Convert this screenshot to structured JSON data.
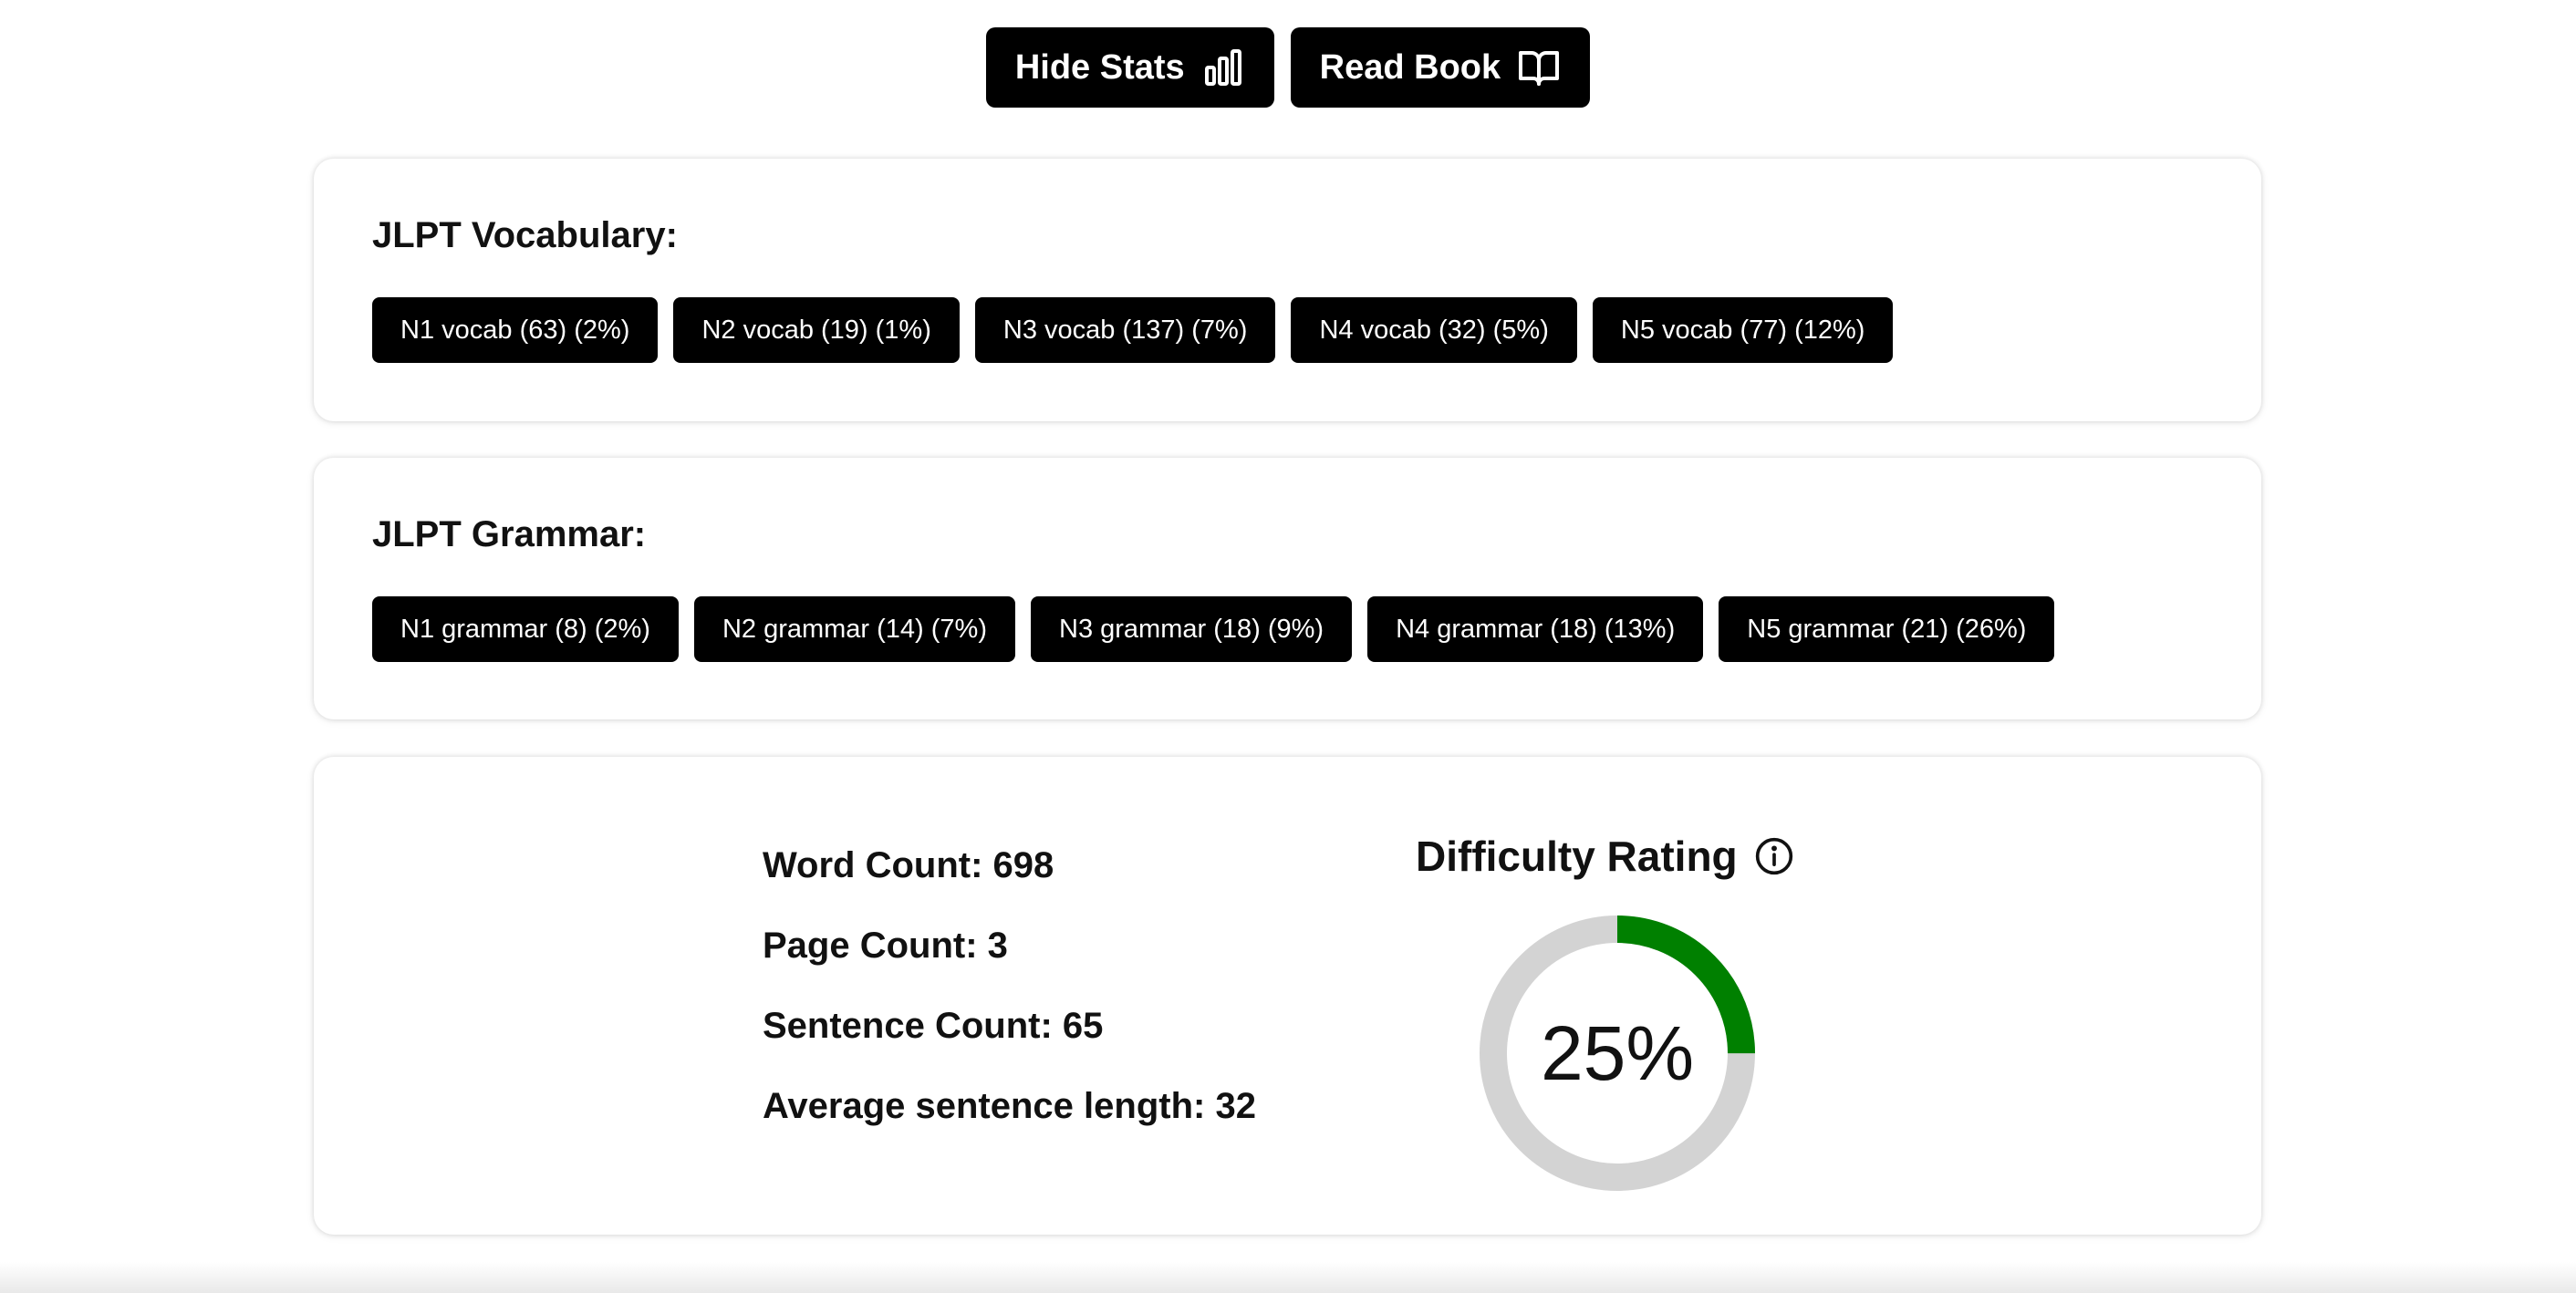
{
  "toolbar": {
    "hide_stats_label": "Hide Stats",
    "read_book_label": "Read Book"
  },
  "vocab": {
    "title": "JLPT Vocabulary:",
    "tags": [
      "N1 vocab (63) (2%)",
      "N2 vocab (19) (1%)",
      "N3 vocab (137) (7%)",
      "N4 vocab (32) (5%)",
      "N5 vocab (77) (12%)"
    ]
  },
  "grammar": {
    "title": "JLPT Grammar:",
    "tags": [
      "N1 grammar (8) (2%)",
      "N2 grammar (14) (7%)",
      "N3 grammar (18) (9%)",
      "N4 grammar (18) (13%)",
      "N5 grammar (21) (26%)"
    ]
  },
  "stats": {
    "word_count": "Word Count: 698",
    "page_count": "Page Count: 3",
    "sentence_count": "Sentence Count: 65",
    "avg_sentence_length": "Average sentence length: 32"
  },
  "difficulty": {
    "title": "Difficulty Rating",
    "value_text": "25%",
    "value": 0.25,
    "colors": {
      "fill": "#008000",
      "track": "#d3d3d3"
    }
  }
}
